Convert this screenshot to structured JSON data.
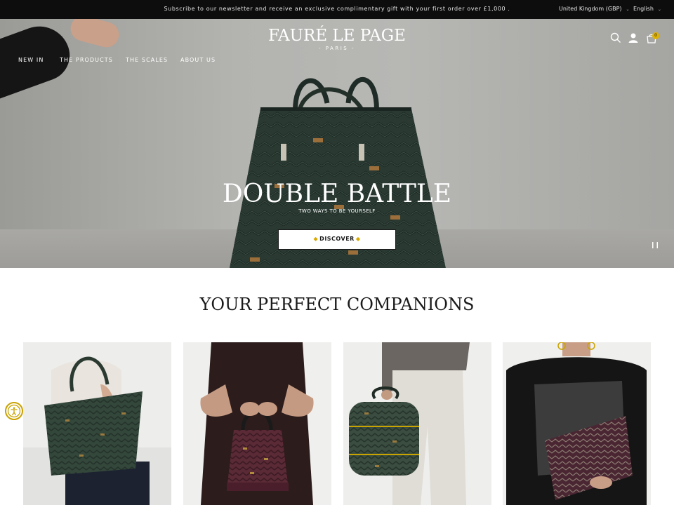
{
  "announcement": {
    "message": "Subscribe to our newsletter and receive an exclusive complimentary gift with your first order over £1,000 .",
    "region": "United Kingdom (GBP)",
    "language": "English"
  },
  "header": {
    "nav": [
      "NEW IN",
      "THE PRODUCTS",
      "THE SCALES",
      "ABOUT US"
    ],
    "logo_brand": "FAURÉ LE PAGE",
    "logo_city": "- PARIS -",
    "cart_count": "0"
  },
  "hero": {
    "title": "DOUBLE BATTLE",
    "subtitle": "TWO WAYS TO BE YOURSELF",
    "cta": "DISCOVER"
  },
  "section": {
    "title": "YOUR PERFECT COMPANIONS"
  },
  "colors": {
    "accent": "#e0b200",
    "bag_green": "#2e3f35",
    "bag_burgundy": "#4a2430",
    "dark": "#0d0d0d"
  },
  "icons": [
    "search-icon",
    "account-icon",
    "cart-icon",
    "pause-icon",
    "accessibility-icon",
    "chevron-down-icon"
  ]
}
